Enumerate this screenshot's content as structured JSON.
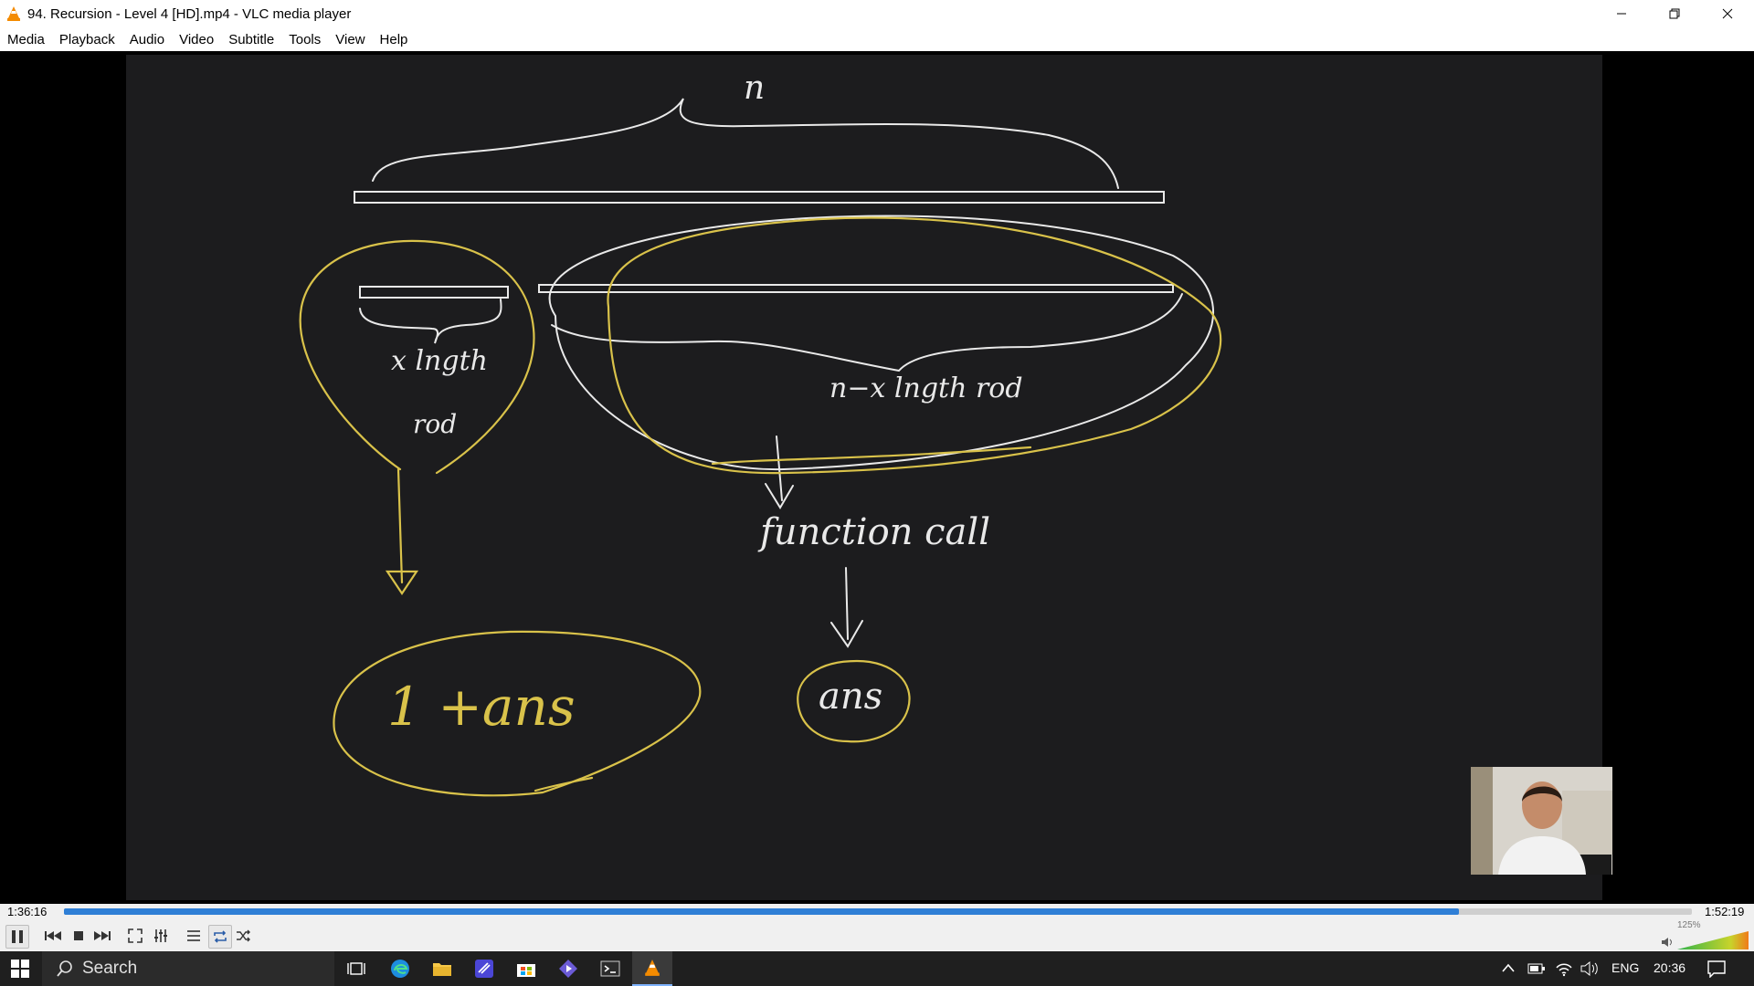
{
  "window": {
    "title": "94. Recursion - Level 4 [HD].mp4 - VLC media player"
  },
  "menu": [
    "Media",
    "Playback",
    "Audio",
    "Video",
    "Subtitle",
    "Tools",
    "View",
    "Help"
  ],
  "board": {
    "top_label": "n",
    "left_label_1": "x lngth",
    "left_label_2": "rod",
    "right_label": "n−x lngth rod",
    "mid_label": "function call",
    "left_result": "1 +ans",
    "right_result": "ans"
  },
  "playback": {
    "elapsed": "1:36:16",
    "total": "1:52:19",
    "progress_fraction": 0.857,
    "volume": "125%",
    "volume_fraction": 1.0
  },
  "taskbar": {
    "search_placeholder": "Search",
    "language": "ENG",
    "clock": "20:36"
  },
  "colors": {
    "accent": "#2f7fd6",
    "ink_white": "#e9e9e9",
    "ink_yellow": "#d9c24a"
  }
}
